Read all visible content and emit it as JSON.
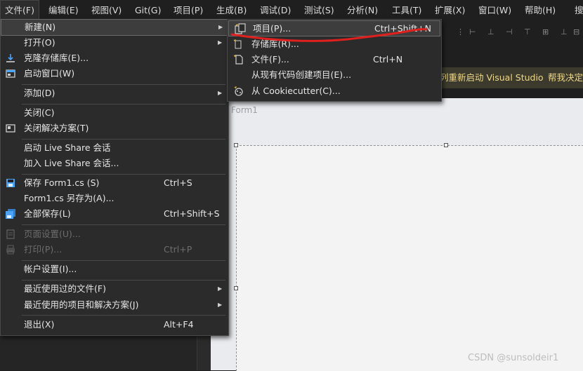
{
  "menubar": {
    "items": [
      "文件(F)",
      "编辑(E)",
      "视图(V)",
      "Git(G)",
      "项目(P)",
      "生成(B)",
      "调试(D)",
      "测试(S)",
      "分析(N)",
      "工具(T)",
      "扩展(X)",
      "窗口(W)",
      "帮助(H)",
      "搜"
    ]
  },
  "infobar": {
    "text": "列重新启动 Visual Studio",
    "link": "帮我决定"
  },
  "designer": {
    "form_title": "Form1"
  },
  "watermark": "CSDN @sunsoldeir1",
  "file_menu": {
    "new": "新建(N)",
    "open": "打开(O)",
    "clone": "克隆存储库(E)...",
    "start_window": "启动窗口(W)",
    "add": "添加(D)",
    "close": "关闭(C)",
    "close_solution": "关闭解决方案(T)",
    "live_share_start": "启动 Live Share 会话",
    "live_share_join": "加入 Live Share 会话...",
    "save": "保存 Form1.cs (S)",
    "save_shortcut": "Ctrl+S",
    "save_as": "Form1.cs 另存为(A)...",
    "save_all": "全部保存(L)",
    "save_all_shortcut": "Ctrl+Shift+S",
    "page_setup": "页面设置(U)...",
    "print": "打印(P)...",
    "print_shortcut": "Ctrl+P",
    "account": "帐户设置(I)...",
    "recent_files": "最近使用过的文件(F)",
    "recent_projects": "最近使用的项目和解决方案(J)",
    "exit": "退出(X)",
    "exit_shortcut": "Alt+F4"
  },
  "new_submenu": {
    "project": "项目(P)...",
    "project_shortcut": "Ctrl+Shift+N",
    "repository": "存储库(R)...",
    "file": "文件(F)...",
    "file_shortcut": "Ctrl+N",
    "from_existing": "从现有代码创建项目(E)...",
    "cookiecutter": "从 Cookiecutter(C)..."
  },
  "colors": {
    "menu_bg": "#2b2b2b",
    "annotation_red": "#e0201e",
    "infobar_text": "#f0d98a"
  }
}
